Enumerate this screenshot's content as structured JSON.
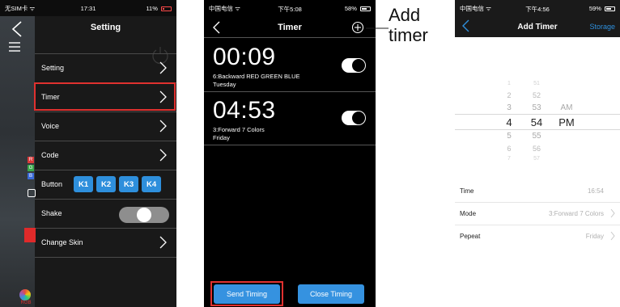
{
  "screen1": {
    "status": {
      "left": "无SIM卡 ᯤ",
      "time": "17:31",
      "battery": "11%"
    },
    "title": "Setting",
    "rgb_letters": [
      "R",
      "G",
      "B"
    ],
    "items": [
      {
        "label": "Setting"
      },
      {
        "label": "Timer"
      },
      {
        "label": "Voice"
      },
      {
        "label": "Code"
      }
    ],
    "button_row": {
      "label": "Button",
      "keys": [
        "K1",
        "K2",
        "K3",
        "K4"
      ]
    },
    "shake": {
      "label": "Shake",
      "on": false
    },
    "change_skin": {
      "label": "Change Skin"
    },
    "bottom_nav": [
      "RGB"
    ],
    "colors": {
      "highlight": "#e0312f",
      "key": "#2e8fdc"
    }
  },
  "screen2": {
    "status": {
      "left": "中国电信 ᯤ",
      "time": "下午5:08",
      "battery": "58%"
    },
    "title": "Timer",
    "timers": [
      {
        "time": "00:09",
        "mode": "6:Backward RED GREEN BLUE",
        "day": "Tuesday",
        "enabled": true
      },
      {
        "time": "04:53",
        "mode": "3:Forward 7 Colors",
        "day": "Friday",
        "enabled": true
      }
    ],
    "send_label": "Send Timing",
    "close_label": "Close Timing"
  },
  "annotation": {
    "line1": "Add",
    "line2": "timer"
  },
  "screen3": {
    "status": {
      "left": "中国电信 ᯤ",
      "time": "下午4:56",
      "battery": "59%"
    },
    "title": "Add Timer",
    "storage_label": "Storage",
    "picker": {
      "hours": [
        "1",
        "2",
        "3",
        "4",
        "5",
        "6",
        "7"
      ],
      "minutes": [
        "51",
        "52",
        "53",
        "54",
        "55",
        "56",
        "57"
      ],
      "ampm": [
        "AM",
        "PM"
      ],
      "selected_hour": "4",
      "selected_minute": "54",
      "selected_ampm": "PM"
    },
    "rows": [
      {
        "label": "Time",
        "value": "16:54"
      },
      {
        "label": "Mode",
        "value": "3:Forward 7 Colors"
      },
      {
        "label": "Pepeat",
        "value": "Friday"
      }
    ]
  }
}
